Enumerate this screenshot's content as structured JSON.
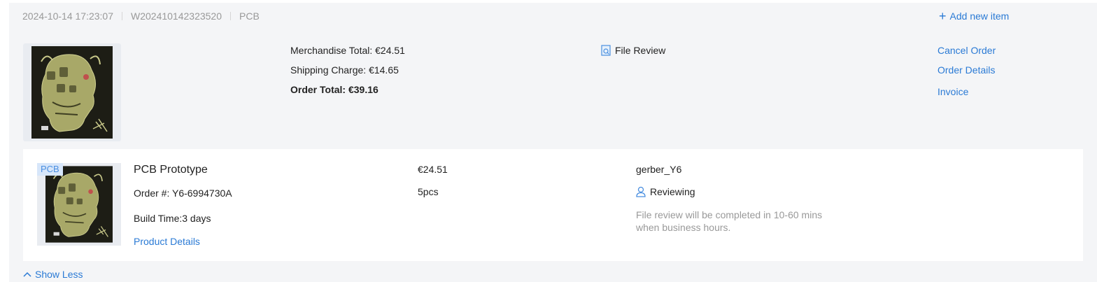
{
  "header": {
    "datetime": "2024-10-14 17:23:07",
    "order_id": "W202410142323520",
    "category": "PCB",
    "add_item_label": "Add new item"
  },
  "summary": {
    "merchandise_total": "Merchandise Total: €24.51",
    "shipping_charge": "Shipping Charge: €14.65",
    "order_total": "Order Total: €39.16",
    "file_review_label": "File Review"
  },
  "actions": {
    "cancel": "Cancel Order",
    "details": "Order Details",
    "invoice": "Invoice"
  },
  "item": {
    "badge": "PCB",
    "title": "PCB Prototype",
    "order_number": "Order #: Y6-6994730A",
    "build_time": "Build Time:3 days",
    "details_link": "Product Details",
    "price": "€24.51",
    "quantity": "5pcs",
    "file_name": "gerber_Y6",
    "status": "Reviewing",
    "review_note": "File review will be completed in 10-60 mins when business hours."
  },
  "footer": {
    "show_less": "Show Less"
  },
  "colors": {
    "link": "#2a7ad5",
    "muted": "#999999",
    "card_bg": "#f4f5f7"
  }
}
